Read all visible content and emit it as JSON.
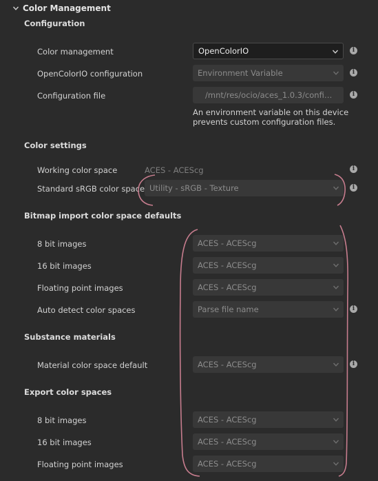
{
  "header": {
    "title": "Color Management"
  },
  "configuration": {
    "title": "Configuration",
    "rows": [
      {
        "label": "Color management",
        "value": "OpenColorIO"
      },
      {
        "label": "OpenColorIO configuration",
        "value": "Environment Variable"
      },
      {
        "label": "Configuration file",
        "value": "/mnt/res/ocio/aces_1.0.3/config..."
      }
    ],
    "note": "An environment variable on this device prevents custom configuration files."
  },
  "color_settings": {
    "title": "Color settings",
    "working_label": "Working color space",
    "working_value": "ACES - ACEScg",
    "srgb_label": "Standard sRGB color space",
    "srgb_value": "Utility - sRGB - Texture"
  },
  "bitmap": {
    "title": "Bitmap import color space defaults",
    "rows": [
      {
        "label": "8 bit images",
        "value": "ACES - ACEScg"
      },
      {
        "label": "16 bit images",
        "value": "ACES - ACEScg"
      },
      {
        "label": "Floating point images",
        "value": "ACES - ACEScg"
      },
      {
        "label": "Auto detect color spaces",
        "value": "Parse file name"
      }
    ]
  },
  "substance": {
    "title": "Substance materials",
    "label": "Material color space default",
    "value": "ACES - ACEScg"
  },
  "export": {
    "title": "Export color spaces",
    "rows": [
      {
        "label": "8 bit images",
        "value": "ACES - ACEScg"
      },
      {
        "label": "16 bit images",
        "value": "ACES - ACEScg"
      },
      {
        "label": "Floating point images",
        "value": "ACES - ACEScg"
      }
    ]
  },
  "colors": {
    "background": "#2b2b2b",
    "annotation": "#c77d8e"
  }
}
